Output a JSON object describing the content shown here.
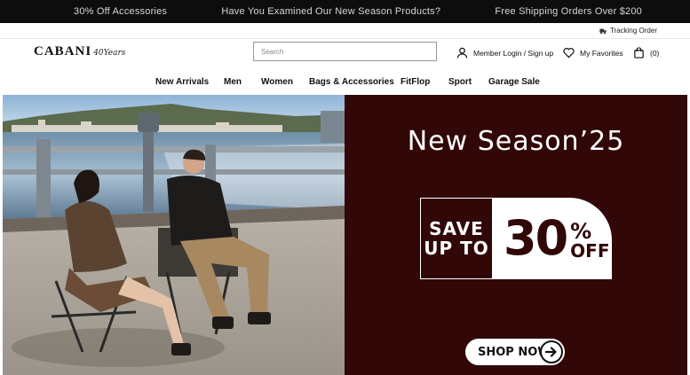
{
  "topbar": {
    "messages": [
      "30% Off Accessories",
      "Have You Examined Our New Season Products?",
      "Free Shipping Orders Over $200"
    ]
  },
  "utility": {
    "tracking_label": "Tracking Order"
  },
  "header": {
    "logo_text": "CABANI",
    "logo_anniversary": "40Years",
    "search_placeholder": "Search",
    "login_label": "Member Login / Sign up",
    "favorites_label": "My Favorites",
    "cart_count": "(0)"
  },
  "nav": {
    "items": [
      "New Arrivals",
      "Men",
      "Women",
      "Bags & Accessories",
      "FitFlop",
      "Sport",
      "Garage Sale"
    ]
  },
  "hero": {
    "headline": "New Season’25",
    "badge_line1": "SAVE",
    "badge_line2": "UP TO",
    "badge_number": "30",
    "badge_percent": "%",
    "badge_off": "OFF",
    "cta_label": "SHOP NOW"
  },
  "colors": {
    "topbar_bg": "#0d0d0d",
    "promo_bg": "#310708",
    "text_dark": "#111111"
  }
}
